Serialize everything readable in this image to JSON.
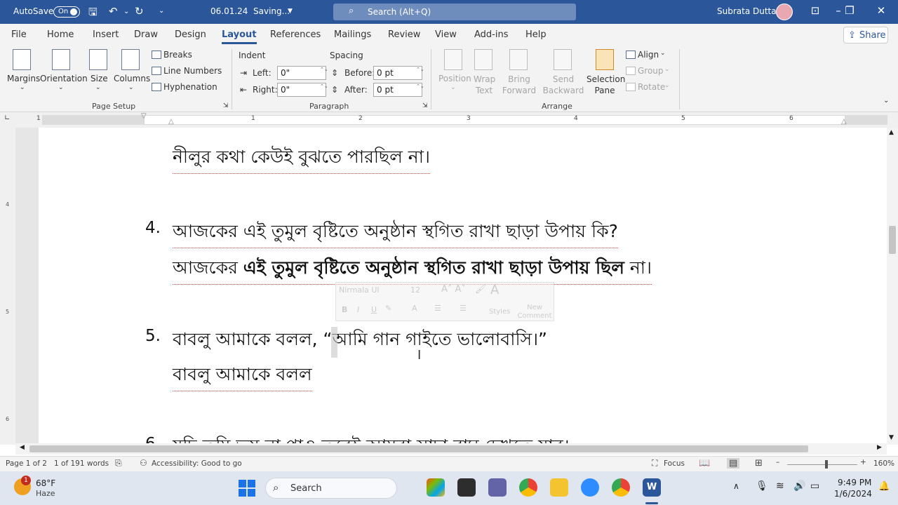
{
  "titlebar": {
    "autosave_label": "AutoSave",
    "autosave_state": "On",
    "filename": "06.01.24",
    "save_status": "Saving...",
    "search_placeholder": "Search (Alt+Q)",
    "user_name": "Subrata Dutta"
  },
  "tabs": [
    "File",
    "Home",
    "Insert",
    "Draw",
    "Design",
    "Layout",
    "References",
    "Mailings",
    "Review",
    "View",
    "Add-ins",
    "Help"
  ],
  "active_tab": "Layout",
  "share_label": "Share",
  "ribbon": {
    "page_setup": {
      "margins": "Margins",
      "orientation": "Orientation",
      "size": "Size",
      "columns": "Columns",
      "breaks": "Breaks",
      "line_numbers": "Line Numbers",
      "hyphenation": "Hyphenation",
      "group_name": "Page Setup"
    },
    "paragraph": {
      "indent_label": "Indent",
      "spacing_label": "Spacing",
      "left_label": "Left:",
      "left_value": "0\"",
      "right_label": "Right:",
      "right_value": "0\"",
      "before_label": "Before:",
      "before_value": "0 pt",
      "after_label": "After:",
      "after_value": "0 pt",
      "group_name": "Paragraph"
    },
    "arrange": {
      "position": "Position",
      "wrap_text": "Wrap Text",
      "bring_forward": "Bring Forward",
      "send_backward": "Send Backward",
      "selection_pane": "Selection Pane",
      "align": "Align",
      "group": "Group",
      "rotate": "Rotate",
      "group_name": "Arrange"
    }
  },
  "ruler_numbers": [
    "1",
    "1",
    "2",
    "3",
    "4",
    "5",
    "6"
  ],
  "vruler_numbers": [
    "4",
    "5",
    "6"
  ],
  "document": {
    "line_top": "নীলুর কথা কেউই বুঝতে পারছিল না।",
    "item4_number": "4.",
    "item4_question": "আজকের এই তুমুল বৃষ্টিতে অনুষ্ঠান স্থগিত রাখা ছাড়া উপায় কি?",
    "item4_answer_start": "আজকের ",
    "item4_answer_bold": "এই তুমুল বৃষ্টিতে অনুষ্ঠান স্থগিত রাখা ছাড়া উপায় ছিল",
    "item4_answer_end": " না।",
    "item5_number": "5.",
    "item5_question": "বাবলু আমাকে বলল, “আমি গান গাইতে ভালোবাসি।”",
    "item5_answer": "বাবলু আমাকে বলল",
    "item6_number": "6.",
    "item6_partial": "যদি তুমি ভয় না পাও তবেই আমরা সাদা বাঘ দেখতে যাব।"
  },
  "mini_toolbar": {
    "font": "Nirmala UI",
    "size": "12",
    "styles": "Styles",
    "new_comment": "New Comment"
  },
  "statusbar": {
    "page": "Page 1 of 2",
    "words": "1 of 191 words",
    "accessibility": "Accessibility: Good to go",
    "focus": "Focus",
    "zoom": "160%"
  },
  "taskbar": {
    "weather_temp": "68°F",
    "weather_desc": "Haze",
    "weather_badge": "1",
    "search_label": "Search",
    "time": "9:49 PM",
    "date": "1/6/2024"
  },
  "colors": {
    "word_blue": "#2b579a",
    "ribbon_bg": "#f3f3f3",
    "taskbar_bg": "#dfe6ef"
  }
}
